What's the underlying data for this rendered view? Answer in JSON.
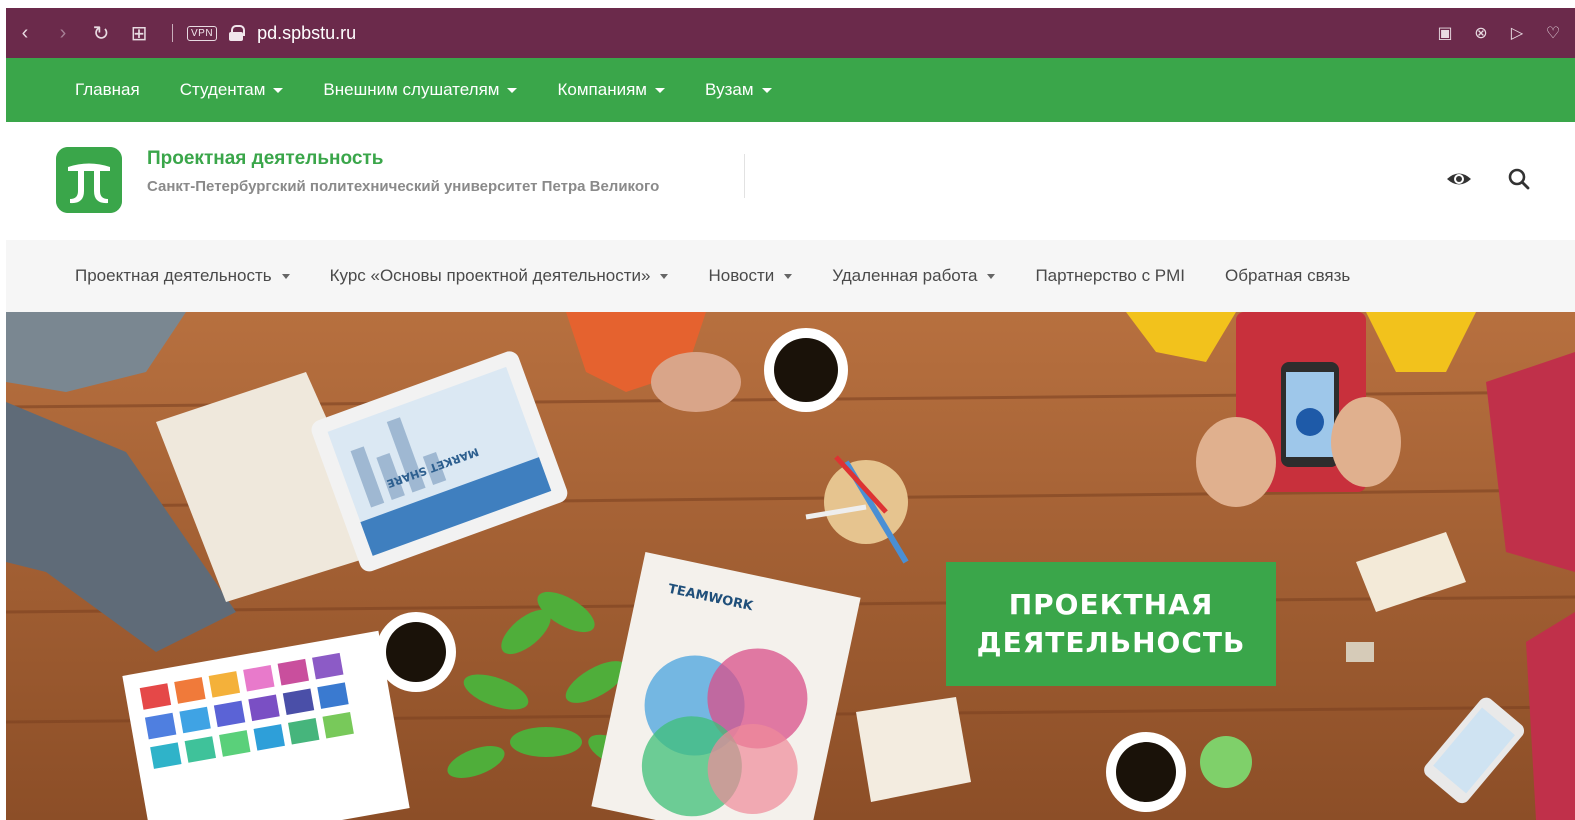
{
  "browser": {
    "url": "pd.spbstu.ru",
    "vpn_label": "VPN"
  },
  "top_nav": [
    {
      "label": "Главная",
      "dropdown": false
    },
    {
      "label": "Студентам",
      "dropdown": true
    },
    {
      "label": "Внешним слушателям",
      "dropdown": true
    },
    {
      "label": "Компаниям",
      "dropdown": true
    },
    {
      "label": "Вузам",
      "dropdown": true
    }
  ],
  "header": {
    "title": "Проектная деятельность",
    "subtitle": "Санкт-Петербургский политехнический университет Петра Великого",
    "icons": [
      "accessibility-eye-icon",
      "search-icon"
    ]
  },
  "sub_nav": [
    {
      "label": "Проектная деятельность",
      "dropdown": true
    },
    {
      "label": "Курс «Основы проектной деятельности»",
      "dropdown": true
    },
    {
      "label": "Новости",
      "dropdown": true
    },
    {
      "label": "Удаленная работа",
      "dropdown": true
    },
    {
      "label": "Партнерство с PMI",
      "dropdown": false
    },
    {
      "label": "Обратная связь",
      "dropdown": false
    }
  ],
  "hero": {
    "badge_line1": "ПРОЕКТНАЯ",
    "badge_line2": "ДЕЯТЕЛЬНОСТЬ",
    "tablet_text": "MARKET SHARE",
    "poster_text": "TEAMWORK",
    "colors": {
      "brand_green": "#3aa64a",
      "chrome": "#6b2a4b",
      "wood": "#b0683a"
    }
  }
}
